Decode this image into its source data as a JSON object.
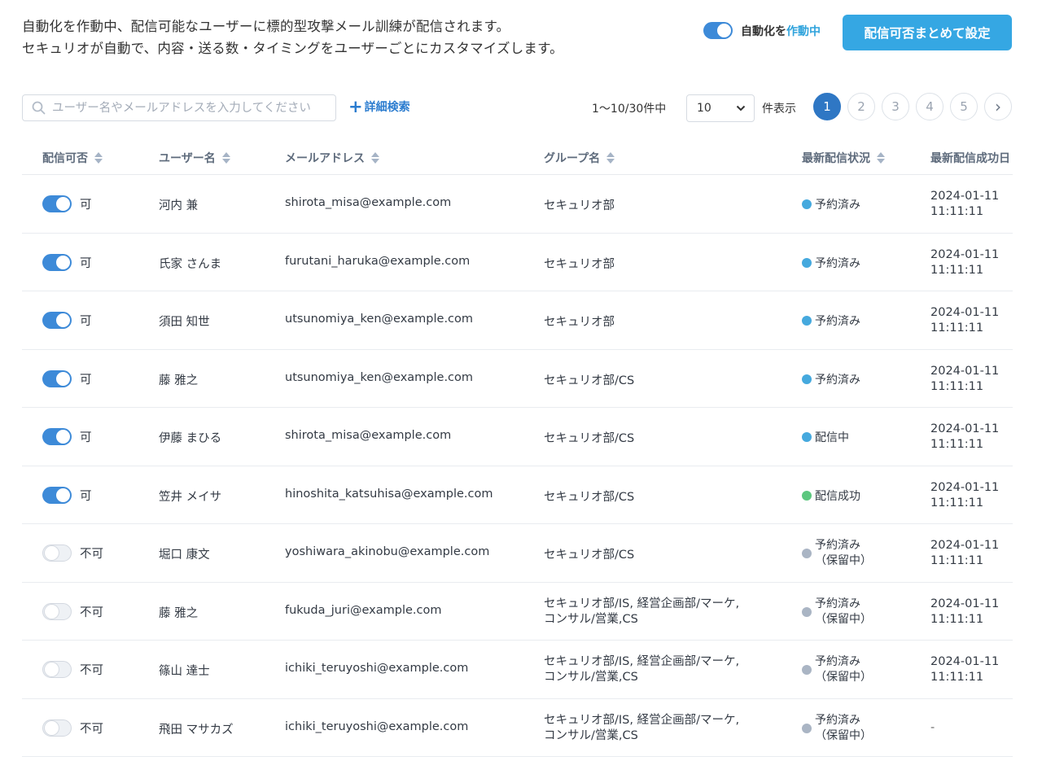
{
  "header": {
    "desc_line1": "自動化を作動中、配信可能なユーザーに標的型攻撃メール訓練が配信されます。",
    "desc_line2": "セキュリオが自動で、内容・送る数・タイミングをユーザーごとにカスタマイズします。",
    "auto_label": "自動化を",
    "auto_state": "作動中",
    "bulk_button": "配信可否まとめて設定"
  },
  "toolbar": {
    "search_placeholder": "ユーザー名やメールアドレスを入力してください",
    "advanced_search": "詳細検索",
    "count": "1〜10/30件中",
    "per_page": "10",
    "per_page_unit": "件表示",
    "pages": [
      "1",
      "2",
      "3",
      "4",
      "5"
    ],
    "next": "›"
  },
  "columns": {
    "toggle": "配信可否",
    "name": "ユーザー名",
    "email": "メールアドレス",
    "group": "グループ名",
    "status": "最新配信状況",
    "date": "最新配信成功日"
  },
  "colors": {
    "accent": "#35a7e3",
    "toggle_on": "#3d8ad8",
    "status_blue": "#45a9de",
    "status_green": "#5cc77f",
    "status_gray": "#aab5c4"
  },
  "rows": [
    {
      "enabled": true,
      "toggle_label": "可",
      "name": "河内 兼",
      "email": "shirota_misa@example.com",
      "group1": "セキュリオ部",
      "group2": "",
      "status1": "予約済み",
      "status2": "",
      "status_color": "#45a9de",
      "date1": "2024-01-11",
      "date2": "11:11:11"
    },
    {
      "enabled": true,
      "toggle_label": "可",
      "name": "氏家 さんま",
      "email": "furutani_haruka@example.com",
      "group1": "セキュリオ部",
      "group2": "",
      "status1": "予約済み",
      "status2": "",
      "status_color": "#45a9de",
      "date1": "2024-01-11",
      "date2": "11:11:11"
    },
    {
      "enabled": true,
      "toggle_label": "可",
      "name": "須田 知世",
      "email": "utsunomiya_ken@example.com",
      "group1": "セキュリオ部",
      "group2": "",
      "status1": "予約済み",
      "status2": "",
      "status_color": "#45a9de",
      "date1": "2024-01-11",
      "date2": "11:11:11"
    },
    {
      "enabled": true,
      "toggle_label": "可",
      "name": "藤 雅之",
      "email": "utsunomiya_ken@example.com",
      "group1": "セキュリオ部/CS",
      "group2": "",
      "status1": "予約済み",
      "status2": "",
      "status_color": "#45a9de",
      "date1": "2024-01-11",
      "date2": "11:11:11"
    },
    {
      "enabled": true,
      "toggle_label": "可",
      "name": "伊藤 まひる",
      "email": "shirota_misa@example.com",
      "group1": "セキュリオ部/CS",
      "group2": "",
      "status1": "配信中",
      "status2": "",
      "status_color": "#45a9de",
      "date1": "2024-01-11",
      "date2": "11:11:11"
    },
    {
      "enabled": true,
      "toggle_label": "可",
      "name": "笠井 メイサ",
      "email": "hinoshita_katsuhisa@example.com",
      "group1": "セキュリオ部/CS",
      "group2": "",
      "status1": "配信成功",
      "status2": "",
      "status_color": "#5cc77f",
      "date1": "2024-01-11",
      "date2": "11:11:11"
    },
    {
      "enabled": false,
      "toggle_label": "不可",
      "name": "堀口 康文",
      "email": "yoshiwara_akinobu@example.com",
      "group1": "セキュリオ部/CS",
      "group2": "",
      "status1": "予約済み",
      "status2": "（保留中）",
      "status_color": "#aab5c4",
      "date1": "2024-01-11",
      "date2": "11:11:11"
    },
    {
      "enabled": false,
      "toggle_label": "不可",
      "name": "藤 雅之",
      "email": "fukuda_juri@example.com",
      "group1": "セキュリオ部/IS, 経営企画部/マーケ,",
      "group2": "コンサル/営業,CS",
      "status1": "予約済み",
      "status2": "（保留中）",
      "status_color": "#aab5c4",
      "date1": "2024-01-11",
      "date2": "11:11:11"
    },
    {
      "enabled": false,
      "toggle_label": "不可",
      "name": "篠山 達士",
      "email": "ichiki_teruyoshi@example.com",
      "group1": "セキュリオ部/IS, 経営企画部/マーケ,",
      "group2": "コンサル/営業,CS",
      "status1": "予約済み",
      "status2": "（保留中）",
      "status_color": "#aab5c4",
      "date1": "2024-01-11",
      "date2": "11:11:11"
    },
    {
      "enabled": false,
      "toggle_label": "不可",
      "name": "飛田 マサカズ",
      "email": "ichiki_teruyoshi@example.com",
      "group1": "セキュリオ部/IS, 経営企画部/マーケ,",
      "group2": "コンサル/営業,CS",
      "status1": "予約済み",
      "status2": "（保留中）",
      "status_color": "#aab5c4",
      "date1": "-",
      "date2": ""
    }
  ]
}
